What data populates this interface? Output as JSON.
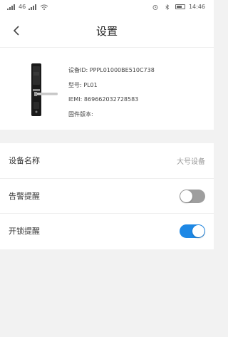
{
  "status_bar": {
    "left_indicators": "46",
    "time": "14:46"
  },
  "nav": {
    "title": "设置",
    "back_icon": "chevron-left-icon"
  },
  "device": {
    "id_label": "设备ID:",
    "id_value": "PPPL01000BE510C738",
    "model_label": "型号:",
    "model_value": "PL01",
    "imei_label": "IEMI:",
    "imei_value": "869662032728583",
    "firmware_label": "固件版本:",
    "firmware_value": ""
  },
  "settings": {
    "device_name_label": "设备名称",
    "device_name_value": "大号设备",
    "alarm_label": "告警提醒",
    "alarm_enabled": false,
    "unlock_label": "开锁提醒",
    "unlock_enabled": true
  },
  "colors": {
    "toggle_on": "#1e88e5",
    "toggle_off": "#9e9e9e"
  }
}
